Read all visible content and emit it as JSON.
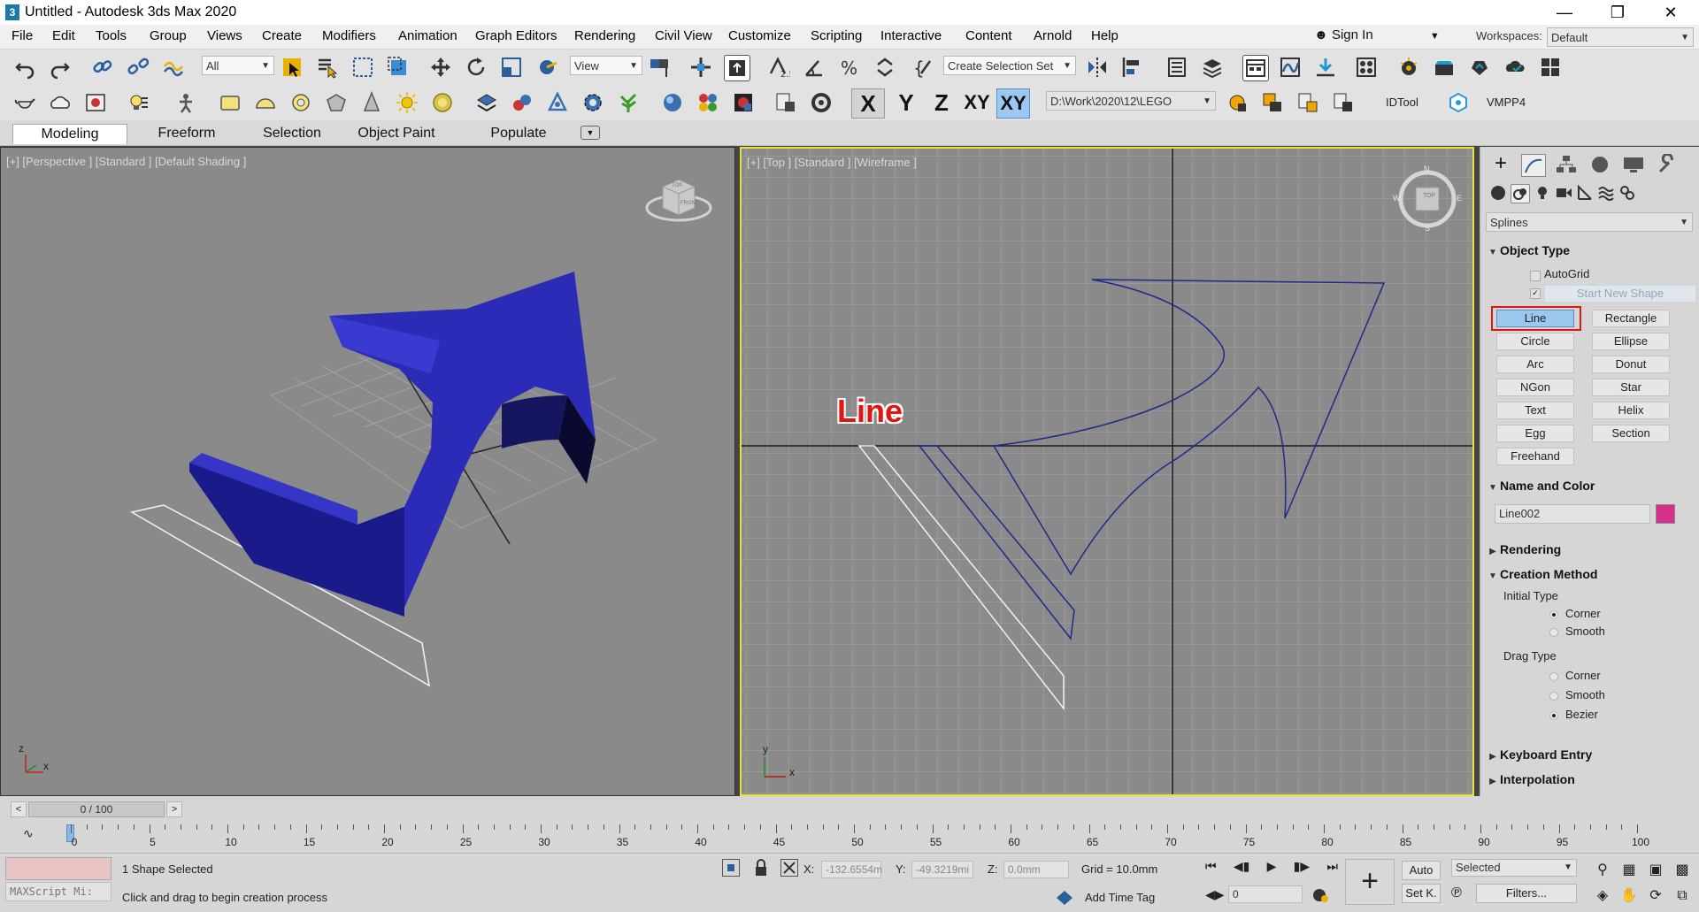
{
  "window": {
    "title": "Untitled - Autodesk 3ds Max 2020",
    "app_icon": "3"
  },
  "menu": [
    "File",
    "Edit",
    "Tools",
    "Group",
    "Views",
    "Create",
    "Modifiers",
    "Animation",
    "Graph Editors",
    "Rendering",
    "Civil View",
    "Customize",
    "Scripting",
    "Interactive",
    "Content",
    "Arnold",
    "Help"
  ],
  "account": {
    "sign_in": "Sign In",
    "workspaces_label": "Workspaces:",
    "workspace_value": "Default"
  },
  "toolbar1": {
    "filter_value": "All",
    "refcoord_value": "View",
    "selection_set_placeholder": "Create Selection Set"
  },
  "toolbar2": {
    "axis_x": "X",
    "axis_y": "Y",
    "axis_z": "Z",
    "axis_xy": "XY",
    "axis_xy2": "XY",
    "project_path": "D:\\Work\\2020\\12\\LEGO",
    "idtool": "IDTool",
    "vmpp4": "VMPP4"
  },
  "ribbon_tabs": [
    "Modeling",
    "Freeform",
    "Selection",
    "Object Paint",
    "Populate"
  ],
  "viewports": {
    "perspective_label": "[+] [Perspective ] [Standard ] [Default Shading ]",
    "top_label": "[+] [Top ] [Standard ] [Wireframe ]",
    "annotation": "Line",
    "viewcube_top": "TOP",
    "viewcube_front": "FRONT",
    "compass": {
      "n": "N",
      "s": "S",
      "e": "E",
      "w": "W"
    },
    "axis_x": "x",
    "axis_y": "y",
    "axis_z": "z"
  },
  "command_panel": {
    "category": "Splines",
    "object_type": {
      "title": "Object Type",
      "autogrid": "AutoGrid",
      "start_new_shape": "Start New Shape",
      "buttons": [
        "Line",
        "Rectangle",
        "Circle",
        "Ellipse",
        "Arc",
        "Donut",
        "NGon",
        "Star",
        "Text",
        "Helix",
        "Egg",
        "Section",
        "Freehand"
      ]
    },
    "name_and_color": {
      "title": "Name and Color",
      "name": "Line002",
      "color": "#d6308a"
    },
    "rendering": {
      "title": "Rendering"
    },
    "creation_method": {
      "title": "Creation Method",
      "initial_type_label": "Initial Type",
      "initial_type_options": [
        "Corner",
        "Smooth"
      ],
      "initial_type_selected": "Corner",
      "drag_type_label": "Drag Type",
      "drag_type_options": [
        "Corner",
        "Smooth",
        "Bezier"
      ],
      "drag_type_selected": "Bezier"
    },
    "keyboard_entry": {
      "title": "Keyboard Entry"
    },
    "interpolation": {
      "title": "Interpolation"
    }
  },
  "timeline": {
    "frame_display": "0 / 100",
    "prev": "<",
    "next": ">",
    "ticks": [
      "0",
      "5",
      "10",
      "15",
      "20",
      "25",
      "30",
      "35",
      "40",
      "45",
      "50",
      "55",
      "60",
      "65",
      "70",
      "75",
      "80",
      "85",
      "90",
      "95",
      "100"
    ]
  },
  "status": {
    "maxscript_placeholder": "MAXScript Mi:",
    "selection": "1 Shape Selected",
    "prompt": "Click and drag to begin creation process",
    "x_label": "X:",
    "x_value": "-132.6554m",
    "y_label": "Y:",
    "y_value": "-49.3219mi",
    "z_label": "Z:",
    "z_value": "0.0mm",
    "grid": "Grid = 10.0mm",
    "add_time_tag": "Add Time Tag",
    "frame_value": "0",
    "auto_key": "Auto",
    "set_key": "Set K.",
    "key_filter_value": "Selected",
    "filters": "Filters..."
  }
}
